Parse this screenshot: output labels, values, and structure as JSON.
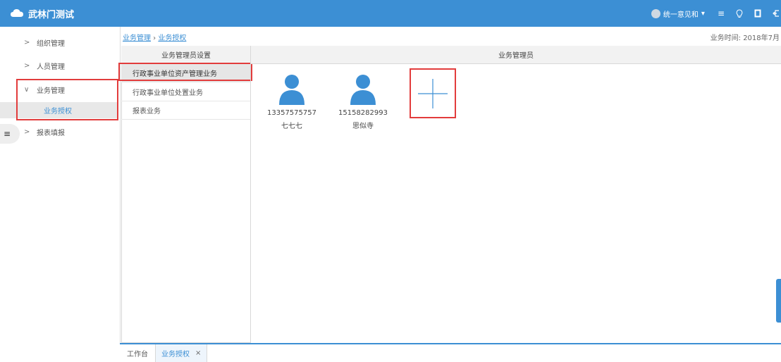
{
  "app": {
    "title": "武林门测试"
  },
  "header": {
    "user_name": "统一意见和",
    "icons": [
      "menu-lines-icon",
      "bulb-icon",
      "fullscreen-icon",
      "logout-icon"
    ]
  },
  "sidebar": {
    "items": [
      {
        "label": "组织管理",
        "arrow": ">"
      },
      {
        "label": "人员管理",
        "arrow": ">"
      },
      {
        "label": "业务管理",
        "arrow": "∨"
      },
      {
        "label": "报表填报",
        "arrow": ">"
      }
    ],
    "sub_item": {
      "label": "业务授权"
    },
    "collapse_icon": "≡"
  },
  "breadcrumb": {
    "parent": "业务管理",
    "separator": " › ",
    "current": "业务授权"
  },
  "biz_time": {
    "label": "业务时间:",
    "value": "2018年7月"
  },
  "left_panel": {
    "title": "业务管理员设置",
    "items": [
      "行政事业单位资产管理业务",
      "行政事业单位处置业务",
      "报表业务"
    ]
  },
  "right_panel": {
    "title": "业务管理员",
    "managers": [
      {
        "phone": "13357575757",
        "name": "七七七"
      },
      {
        "phone": "15158282993",
        "name": "思似寺"
      }
    ],
    "add_icon": "plus-icon"
  },
  "tabs": {
    "home": "工作台",
    "active": "业务授权",
    "close": "×"
  },
  "colors": {
    "brand": "#3c8fd4",
    "highlight": "#e23c3c",
    "selected_bg": "#e6e6e6"
  }
}
